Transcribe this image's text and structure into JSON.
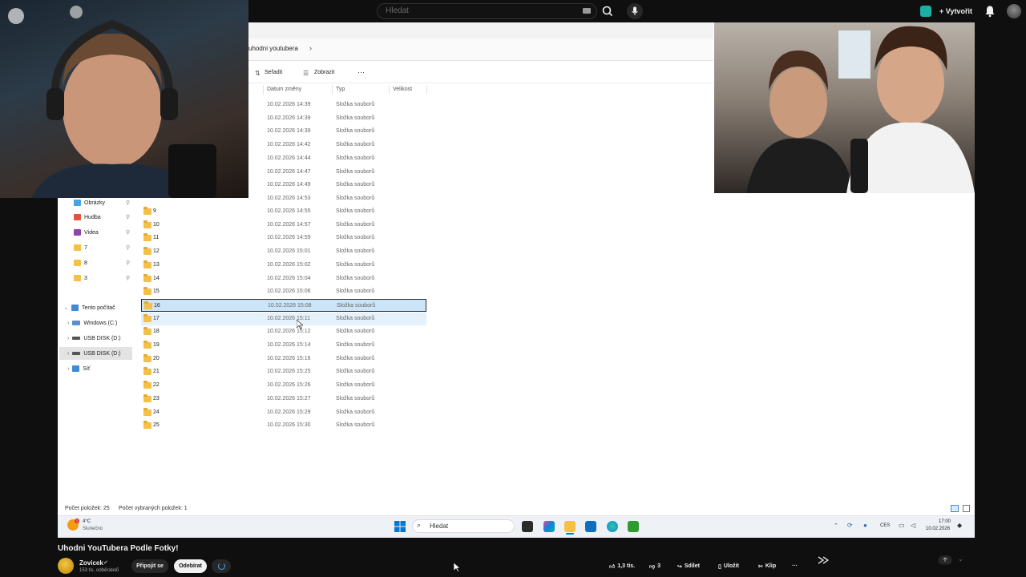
{
  "youtube": {
    "search_placeholder": "Hledat",
    "create_label": "Vytvořit",
    "video_title": "Uhodni YouTubera Podle Fotky!",
    "channel_name": "Zovicek",
    "subscribers": "153 tis. odběratelů",
    "join_label": "Připojit se",
    "unsubscribe_label": "Odebírat",
    "likes": "1,3 tis.",
    "dislikes": "3",
    "share_label": "Sdílet",
    "save_label": "Uložit",
    "clip_label": "Klip",
    "icons": [
      "search-icon",
      "mic-icon",
      "studio-icon",
      "bell-icon",
      "like-icon",
      "dislike-icon",
      "share-icon",
      "save-icon",
      "clip-icon",
      "more-icon"
    ]
  },
  "explorer": {
    "breadcrumb": "uhodni youtubera",
    "toolbar": {
      "sort_label": "Seřadit",
      "view_label": "Zobrazit",
      "more_label": "···"
    },
    "columns": {
      "date": "Datum změny",
      "type": "Typ",
      "size": "Velikost"
    },
    "nav": {
      "pinned": [
        {
          "label": "Obrázky",
          "color": "#4aa3df"
        },
        {
          "label": "Hudba",
          "color": "#e0533d"
        },
        {
          "label": "Videa",
          "color": "#8e44ad"
        },
        {
          "label": "7",
          "color": "#f4c046"
        },
        {
          "label": "8",
          "color": "#f4c046"
        },
        {
          "label": "3",
          "color": "#f4c046"
        }
      ],
      "this_pc": "Tento počítač",
      "drives": [
        "Windows (C:)",
        "USB DISK (D:)",
        "USB DISK (D:)"
      ],
      "network": "Síť"
    },
    "top_rows": [
      {
        "date": "10.02.2026 14:39",
        "type": "Složka souborů"
      },
      {
        "date": "10.02.2026 14:39",
        "type": "Složka souborů"
      },
      {
        "date": "10.02.2026 14:39",
        "type": "Složka souborů"
      },
      {
        "date": "10.02.2026 14:42",
        "type": "Složka souborů"
      },
      {
        "date": "10.02.2026 14:44",
        "type": "Složka souborů"
      },
      {
        "date": "10.02.2026 14:47",
        "type": "Složka souborů"
      },
      {
        "date": "10.02.2026 14:49",
        "type": "Složka souborů"
      },
      {
        "date": "10.02.2026 14:53",
        "type": "Složka souborů"
      }
    ],
    "rows": [
      {
        "name": "9",
        "date": "10.02.2026 14:55",
        "type": "Složka souborů"
      },
      {
        "name": "10",
        "date": "10.02.2026 14:57",
        "type": "Složka souborů"
      },
      {
        "name": "11",
        "date": "10.02.2026 14:59",
        "type": "Složka souborů"
      },
      {
        "name": "12",
        "date": "10.02.2026 15:01",
        "type": "Složka souborů"
      },
      {
        "name": "13",
        "date": "10.02.2026 15:02",
        "type": "Složka souborů"
      },
      {
        "name": "14",
        "date": "10.02.2026 15:04",
        "type": "Složka souborů"
      },
      {
        "name": "15",
        "date": "10.02.2026 15:06",
        "type": "Složka souborů"
      },
      {
        "name": "16",
        "date": "10.02.2026 15:08",
        "type": "Složka souborů",
        "state": "selected"
      },
      {
        "name": "17",
        "date": "10.02.2026 15:11",
        "type": "Složka souborů",
        "state": "hover"
      },
      {
        "name": "18",
        "date": "10.02.2026 15:12",
        "type": "Složka souborů"
      },
      {
        "name": "19",
        "date": "10.02.2026 15:14",
        "type": "Složka souborů"
      },
      {
        "name": "20",
        "date": "10.02.2026 15:16",
        "type": "Složka souborů"
      },
      {
        "name": "21",
        "date": "10.02.2026 15:25",
        "type": "Složka souborů"
      },
      {
        "name": "22",
        "date": "10.02.2026 15:26",
        "type": "Složka souborů"
      },
      {
        "name": "23",
        "date": "10.02.2026 15:27",
        "type": "Složka souborů"
      },
      {
        "name": "24",
        "date": "10.02.2026 15:29",
        "type": "Složka souborů"
      },
      {
        "name": "25",
        "date": "10.02.2026 15:30",
        "type": "Složka souborů"
      }
    ],
    "status": {
      "count": "Počet položek: 25",
      "selected": "Počet vybraných položek: 1"
    }
  },
  "taskbar": {
    "weather_temp": "4°C",
    "weather_cond": "Slunečno",
    "weather_badge": "3",
    "search_label": "Hledat",
    "lang": "CES",
    "time": "17:00",
    "date": "10.02.2026",
    "colors": {
      "start": "#0078d4",
      "explorer": "#f4c046",
      "edge": "#0c8ecf",
      "terminal": "#2d9b2d"
    }
  }
}
